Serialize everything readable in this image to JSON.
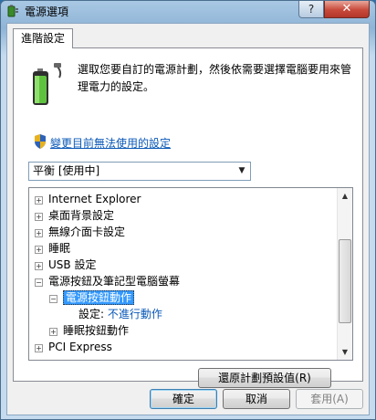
{
  "window": {
    "title": "電源選項"
  },
  "titlebar": {
    "help_label": "?",
    "close_label": "✕"
  },
  "tabs": [
    {
      "label": "進階設定"
    }
  ],
  "description": "選取您要自訂的電源計劃，然後依需要選擇電腦要用來管理電力的設定。",
  "change_link": "變更目前無法使用的設定",
  "plan_select": {
    "value": "平衡 [使用中]"
  },
  "tree": {
    "items": [
      {
        "label": "Internet Explorer",
        "expander": "+"
      },
      {
        "label": "桌面背景設定",
        "expander": "+"
      },
      {
        "label": "無線介面卡設定",
        "expander": "+"
      },
      {
        "label": "睡眠",
        "expander": "+"
      },
      {
        "label": "USB 設定",
        "expander": "+"
      },
      {
        "label": "電源按鈕及筆記型電腦螢幕",
        "expander": "−"
      },
      {
        "label": "電源按鈕動作",
        "expander": "−",
        "selected": true
      },
      {
        "label": "設定:",
        "value": "不進行動作"
      },
      {
        "label": "睡眠按鈕動作",
        "expander": "+"
      },
      {
        "label": "PCI Express",
        "expander": "+"
      }
    ]
  },
  "buttons": {
    "restore": "還原計劃預設值(R)",
    "ok": "確定",
    "cancel": "取消",
    "apply": "套用(A)"
  },
  "icons": {
    "app": "battery-plug-icon",
    "plan": "battery-icon",
    "uac": "shield-icon"
  },
  "colors": {
    "link": "#0b59b8",
    "selection": "#3399ff"
  }
}
